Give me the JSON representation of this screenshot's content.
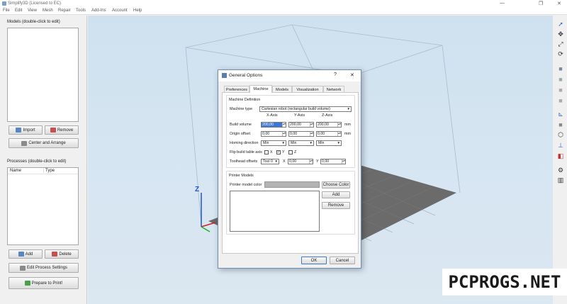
{
  "window": {
    "title": "Simplify3D (Licensed to EC)",
    "minimize": "—",
    "maximize": "❐",
    "close": "✕"
  },
  "menu": [
    "File",
    "Edit",
    "View",
    "Mesh",
    "Repair",
    "Tools",
    "Add-Ins",
    "Account",
    "Help"
  ],
  "models": {
    "label": "Models (double-click to edit)",
    "import": "Import",
    "remove": "Remove",
    "center": "Center and Arrange"
  },
  "processes": {
    "label": "Processes (double-click to edit)",
    "col_name": "Name",
    "col_type": "Type",
    "add": "Add",
    "delete": "Delete",
    "edit": "Edit Process Settings",
    "prepare": "Prepare to Print!"
  },
  "axis_label": "Z",
  "dialog": {
    "title": "General Options",
    "help": "?",
    "close": "✕",
    "tabs": [
      "Preferences",
      "Machine",
      "Models",
      "Visualization",
      "Network"
    ],
    "active_tab": "Machine",
    "machine_definition": "Machine Definition",
    "machine_type_label": "Machine type",
    "machine_type_value": "Cartesian robot (rectangular build volume)",
    "axis_x": "X-Axis",
    "axis_y": "Y-Axis",
    "axis_z": "Z-Axis",
    "build_volume_label": "Build volume",
    "build_volume": [
      "200,00",
      "200,00",
      "200,00"
    ],
    "origin_offset_label": "Origin offset",
    "origin_offset": [
      "0,00",
      "0,00",
      "0,00"
    ],
    "unit": "mm",
    "homing_label": "Homing direction",
    "homing": [
      "Min",
      "Min",
      "Min"
    ],
    "flip_label": "Flip build table axis",
    "flip_x": "X",
    "flip_y": "Y",
    "flip_z": "Z",
    "flip_y_check": "✓",
    "toolhead_label": "Toolhead offsets",
    "toolhead_tool": "Tool 0",
    "toolhead_x_label": "X",
    "toolhead_x": "0,00",
    "toolhead_y_label": "Y",
    "toolhead_y": "0,00",
    "printer_models": "Printer Models",
    "printer_color_label": "Printer model color",
    "choose_color": "Choose Color",
    "add": "Add",
    "remove": "Remove",
    "ok": "OK",
    "cancel": "Cancel"
  },
  "watermark": "PCPROGS.NET",
  "colors": {
    "viewport": "#d3e3f0",
    "bed": "#6a6a6a",
    "accent": "#3b78d8",
    "dialog_border": "#6e8fb5"
  }
}
